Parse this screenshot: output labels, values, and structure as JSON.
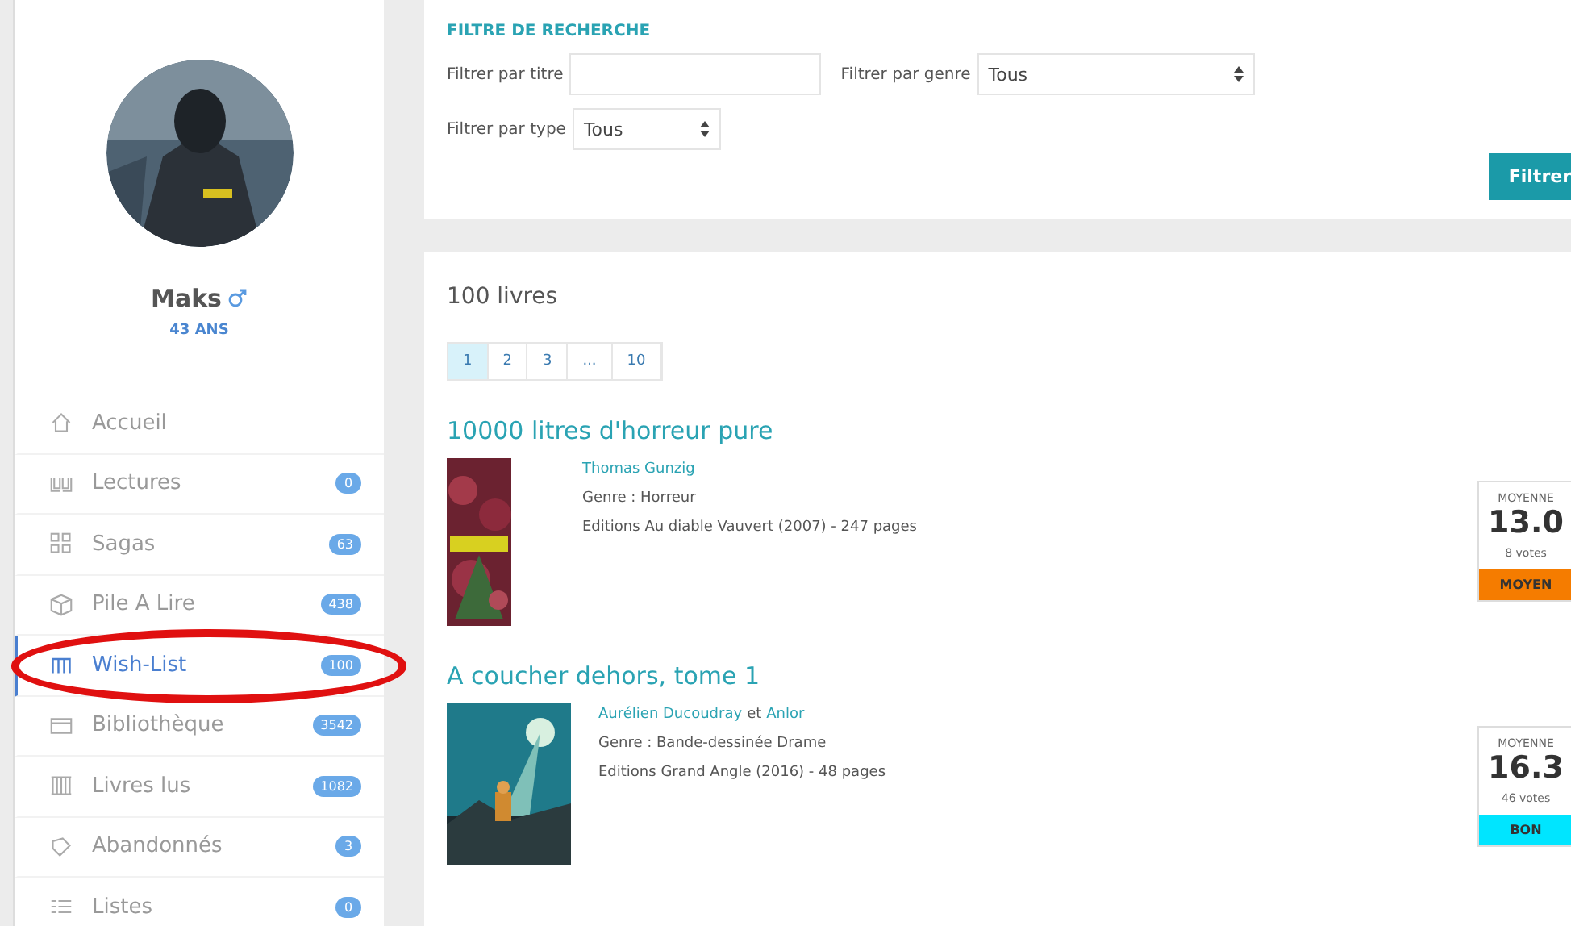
{
  "profile": {
    "name": "Maks",
    "age": "43 ANS"
  },
  "sidebar": {
    "items": [
      {
        "label": "Accueil",
        "selected": false,
        "highlighted": false
      },
      {
        "label": "Lectures",
        "badge": "0",
        "selected": false,
        "highlighted": false
      },
      {
        "label": "Sagas",
        "badge": "63",
        "selected": false,
        "highlighted": false
      },
      {
        "label": "Pile A Lire",
        "badge": "438",
        "selected": false,
        "highlighted": false
      },
      {
        "label": "Wish-List",
        "badge": "100",
        "selected": true,
        "highlighted": true
      },
      {
        "label": "Bibliothèque",
        "badge": "3542",
        "selected": false,
        "highlighted": false
      },
      {
        "label": "Livres lus",
        "badge": "1082",
        "selected": false,
        "highlighted": false
      },
      {
        "label": "Abandonnés",
        "badge": "3",
        "selected": false,
        "highlighted": false
      },
      {
        "label": "Listes",
        "badge": "0",
        "selected": false,
        "highlighted": false
      }
    ]
  },
  "filter": {
    "title": "FILTRE DE RECHERCHE",
    "title_label": "Filtrer par titre",
    "genre_label": "Filtrer par genre",
    "genre_value": "Tous",
    "type_label": "Filtrer par type",
    "type_value": "Tous",
    "button": "Filtrer"
  },
  "results": {
    "count": "100 livres",
    "pages": [
      {
        "label": "1",
        "selected": true
      },
      {
        "label": "2",
        "selected": false
      },
      {
        "label": "3",
        "selected": false
      },
      {
        "label": "...",
        "selected": false
      },
      {
        "label": "10",
        "selected": false
      }
    ],
    "books": [
      {
        "title": "10000 litres d'horreur pure",
        "authors": [
          "Thomas Gunzig"
        ],
        "genre": "Genre : Horreur",
        "edition": "Editions Au diable Vauvert (2007) - 247 pages",
        "rating_label": "MOYENNE",
        "rating": "13.0",
        "votes": "8 votes",
        "verdict": "MOYEN",
        "color": "#f57c00"
      },
      {
        "title": "A coucher dehors, tome 1",
        "authors": [
          "Aurélien Ducoudray",
          "Anlor"
        ],
        "joiner": "et",
        "genre": "Genre : Bande-dessinée Drame",
        "edition": "Editions Grand Angle (2016) - 48 pages",
        "rating_label": "MOYENNE",
        "rating": "16.3",
        "votes": "46 votes",
        "verdict": "BON",
        "color": "#00e5ff"
      }
    ]
  }
}
